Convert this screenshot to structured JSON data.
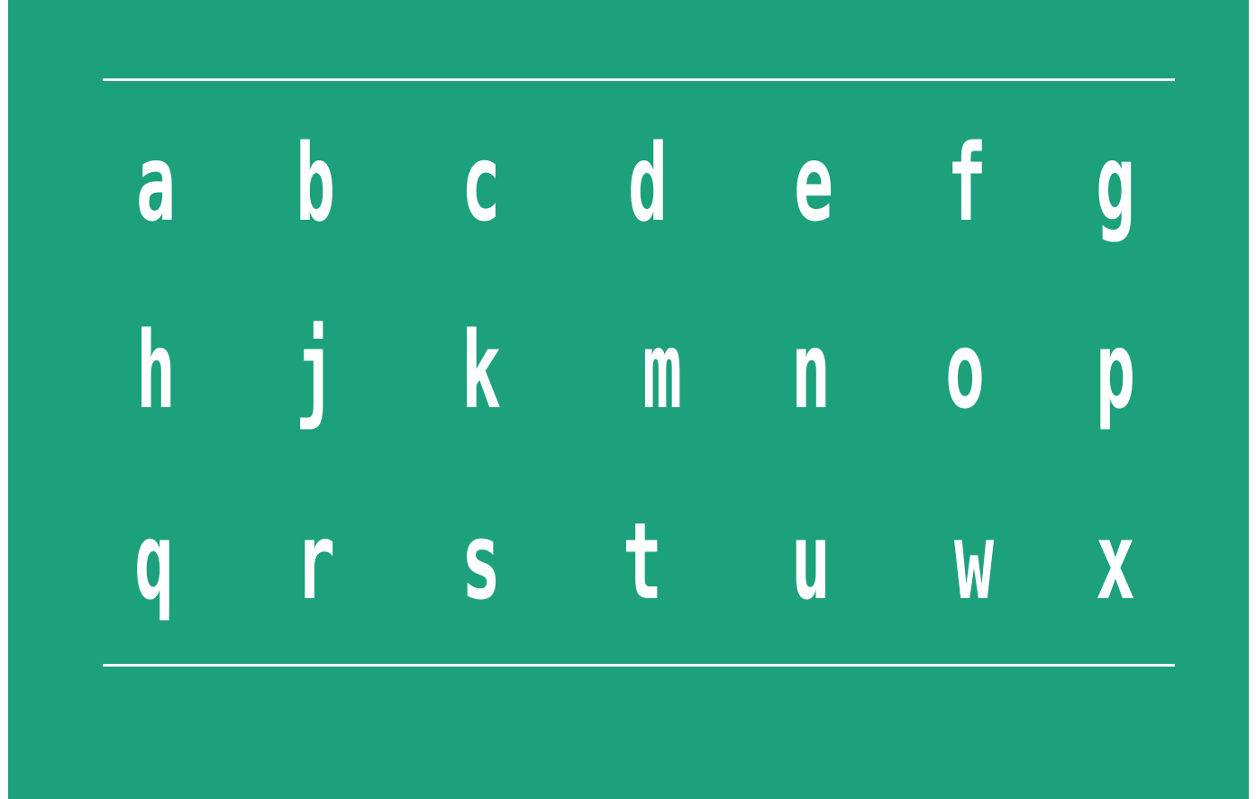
{
  "colors": {
    "background": "#1da07c",
    "glyph": "#ffffff",
    "rule": "#ffffff"
  },
  "rows": [
    [
      "a",
      "b",
      "c",
      "d",
      "e",
      "f",
      "g"
    ],
    [
      "h",
      "j",
      "k",
      "m",
      "n",
      "o",
      "p"
    ],
    [
      "q",
      "r",
      "s",
      "t",
      "u",
      "w",
      "x"
    ]
  ]
}
